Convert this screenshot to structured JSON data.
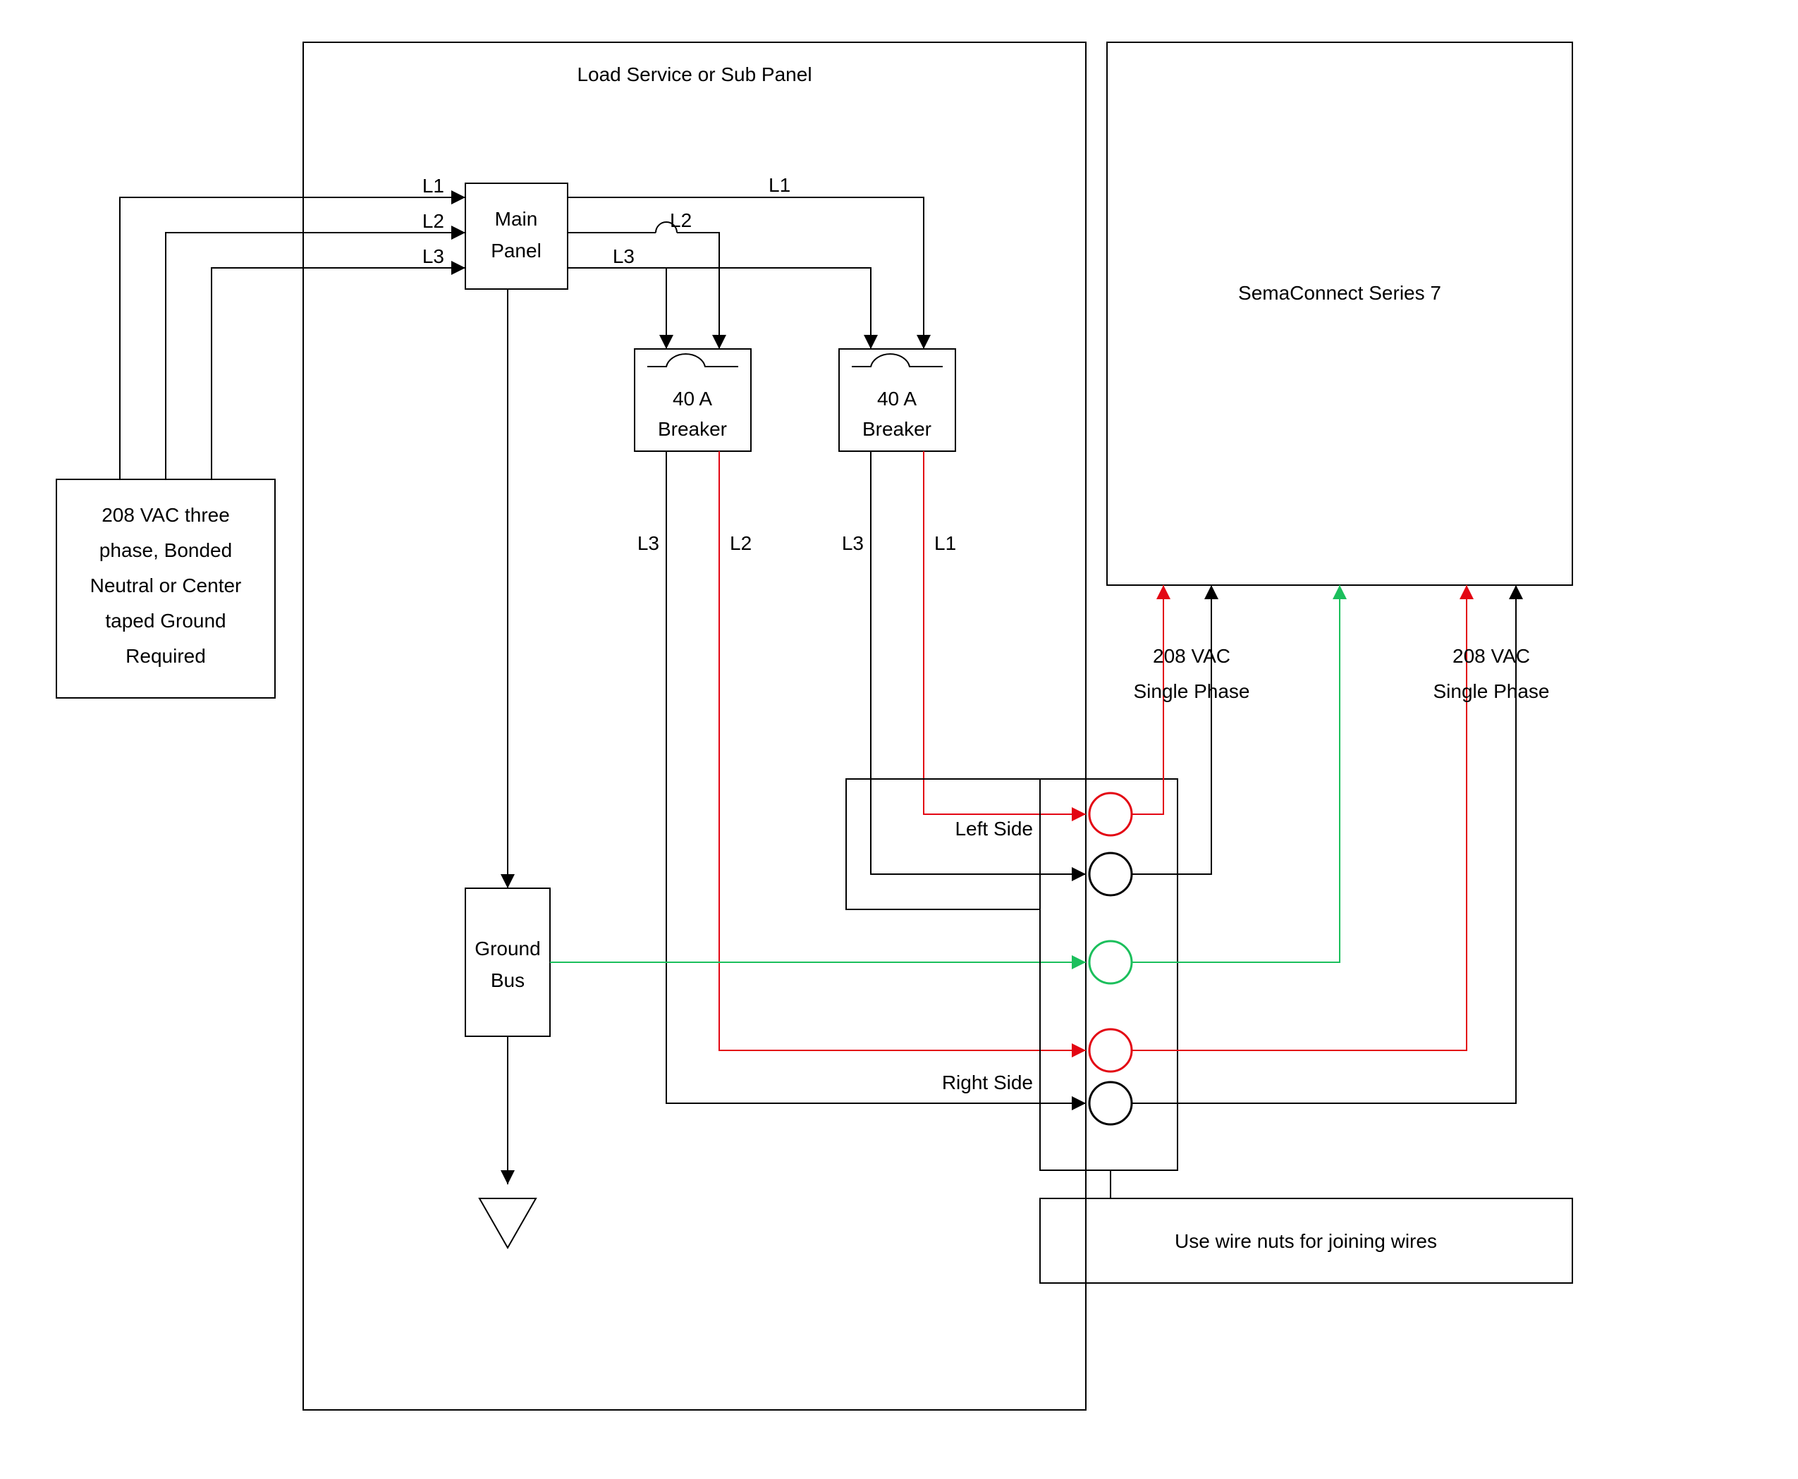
{
  "title": "Load Service or Sub Panel",
  "source": {
    "line1": "208 VAC three",
    "line2": "phase, Bonded",
    "line3": "Neutral or Center",
    "line4": "taped Ground",
    "line5": "Required"
  },
  "mainPanel": {
    "line1": "Main",
    "line2": "Panel"
  },
  "breakerA": {
    "line1": "40 A",
    "line2": "Breaker"
  },
  "breakerB": {
    "line1": "40 A",
    "line2": "Breaker"
  },
  "groundBus": {
    "line1": "Ground",
    "line2": "Bus"
  },
  "wires": {
    "L1": "L1",
    "L2": "L2",
    "L3": "L3"
  },
  "sides": {
    "left": "Left Side",
    "right": "Right Side"
  },
  "device": "SemaConnect Series 7",
  "phaseA": {
    "line1": "208 VAC",
    "line2": "Single Phase"
  },
  "phaseB": {
    "line1": "208 VAC",
    "line2": "Single Phase"
  },
  "note": "Use wire nuts for joining wires",
  "colors": {
    "red": "#e30613",
    "green": "#1bbf5c",
    "black": "#000000"
  }
}
